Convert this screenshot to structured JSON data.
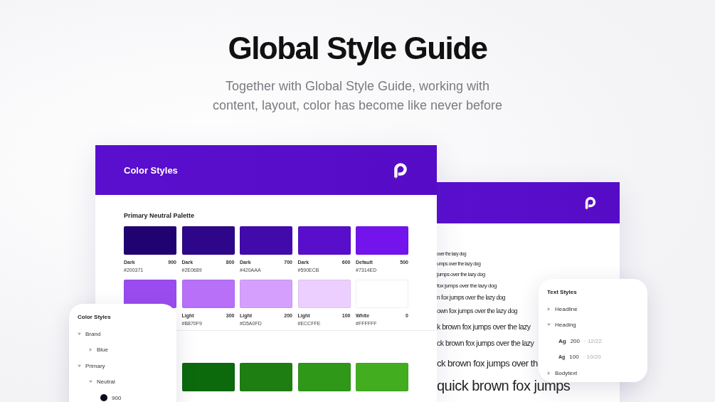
{
  "hero": {
    "title": "Global Style Guide",
    "subtitle": "Together with Global Style Guide, working with content, layout, color has become like never before"
  },
  "color_card": {
    "title": "Color Styles",
    "section": "Primary Neutral Palette",
    "palette_rows": [
      [
        {
          "name": "Dark",
          "step": "900",
          "hex": "#200371",
          "color": "#200371"
        },
        {
          "name": "Dark",
          "step": "800",
          "hex": "#2E0689",
          "color": "#2e0689"
        },
        {
          "name": "Dark",
          "step": "700",
          "hex": "#420AAA",
          "color": "#420aaa"
        },
        {
          "name": "Dark",
          "step": "600",
          "hex": "#590ECB",
          "color": "#590ecb"
        },
        {
          "name": "Default",
          "step": "500",
          "hex": "#7314ED",
          "color": "#7314ed"
        }
      ],
      [
        {
          "color": "#9b4cf0"
        },
        {
          "name": "Light",
          "step": "300",
          "hex": "#B870F9",
          "color": "#b870f9"
        },
        {
          "name": "Light",
          "step": "200",
          "hex": "#D5A0FD",
          "color": "#d5a0fd"
        },
        {
          "name": "Light",
          "step": "100",
          "hex": "#ECCFFE",
          "color": "#eccffe"
        },
        {
          "name": "White",
          "step": "0",
          "hex": "#FFFFFF",
          "color": "#ffffff"
        }
      ],
      [
        {
          "color": "#0c6a0c"
        },
        {
          "color": "#1f7e12"
        },
        {
          "color": "#2f9818"
        },
        {
          "color": "#43ad20"
        }
      ]
    ]
  },
  "specimen_card": {
    "lines": [
      "over the lazy dog",
      "umps over the lazy dog",
      "jumps over the lazy dog",
      "fox jumps over the lazy dog",
      "n fox jumps over the lazy dog",
      "own fox jumps over the lazy dog",
      "k brown fox jumps over the lazy",
      "ck brown fox jumps over the lazy",
      "ck brown fox jumps over th",
      "quick brown fox jumps"
    ]
  },
  "color_tree": {
    "title": "Color Styles",
    "items": [
      {
        "label": "Brand",
        "expanded": true,
        "children": [
          {
            "label": "Blue",
            "expanded": false
          }
        ]
      },
      {
        "label": "Primary",
        "expanded": true,
        "children": [
          {
            "label": "Neutral",
            "expanded": true,
            "children": [
              {
                "label": "900",
                "color": "#0b0b1a"
              }
            ]
          }
        ]
      }
    ]
  },
  "text_styles": {
    "title": "Text Styles",
    "items": [
      {
        "label": "Headline",
        "expanded": false
      },
      {
        "label": "Heading",
        "expanded": true,
        "styles": [
          {
            "sample": "Ag",
            "weight": "200",
            "metrics": "· 12/22"
          },
          {
            "sample": "Ag",
            "weight": "100",
            "metrics": "· 10/20"
          }
        ]
      },
      {
        "label": "Bodytext",
        "expanded": false
      }
    ]
  }
}
